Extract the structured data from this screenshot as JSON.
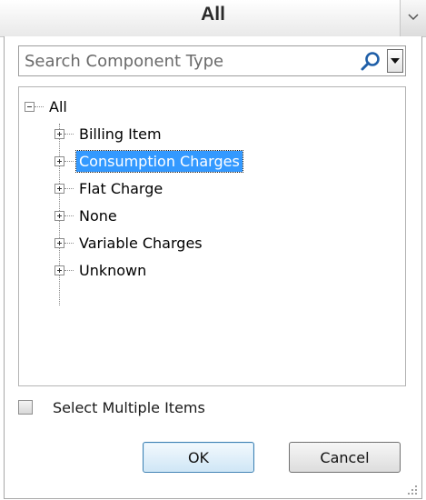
{
  "header": {
    "title": "All"
  },
  "search": {
    "placeholder": "Search Component Type"
  },
  "tree": {
    "root": "All",
    "items": [
      {
        "label": "Billing Item"
      },
      {
        "label": "Consumption Charges",
        "selected": true
      },
      {
        "label": "Flat Charge"
      },
      {
        "label": "None"
      },
      {
        "label": "Variable Charges"
      },
      {
        "label": "Unknown"
      }
    ]
  },
  "options": {
    "select_multiple_label": "Select Multiple Items",
    "select_multiple_checked": false
  },
  "buttons": {
    "ok_label": "OK",
    "cancel_label": "Cancel"
  },
  "colors": {
    "selection": "#3399ff",
    "ok_border": "#3c7fb1",
    "search_icon": "#1f5fa8"
  }
}
